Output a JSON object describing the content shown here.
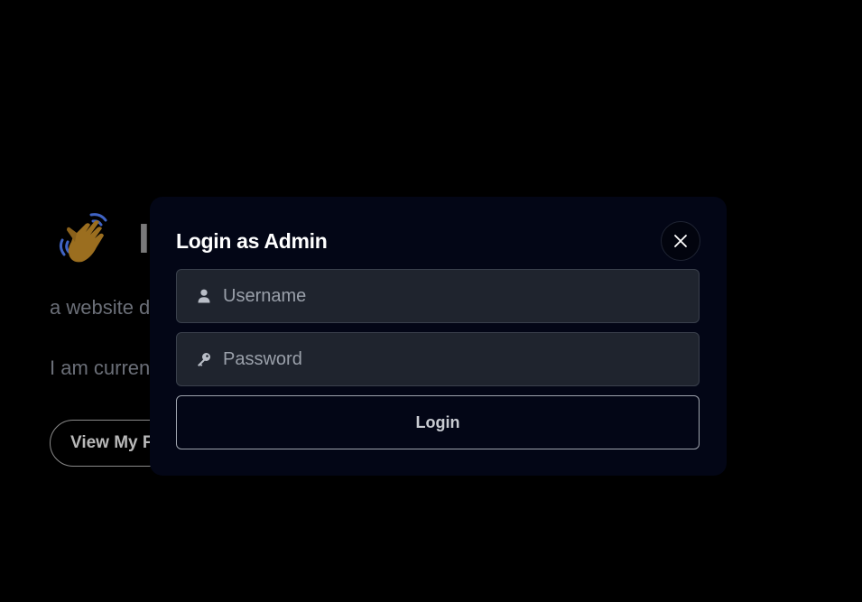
{
  "background": {
    "heading_wave": "waving-hand",
    "heading_text": "I",
    "subtitle_fragment": "a website d",
    "status_fragment": "I am curren",
    "cta_fragment": "View My F"
  },
  "modal": {
    "title": "Login as Admin",
    "close_icon": "close-icon",
    "username": {
      "placeholder": "Username",
      "value": "",
      "icon": "user-icon"
    },
    "password": {
      "placeholder": "Password",
      "value": "",
      "icon": "key-icon"
    },
    "submit_label": "Login"
  },
  "colors": {
    "page_bg": "#000000",
    "modal_bg": "#030616",
    "field_bg": "#1f242e",
    "field_border": "#3a404c",
    "button_border": "#9ea3ad",
    "wave_icon": "#9b6e1f"
  }
}
